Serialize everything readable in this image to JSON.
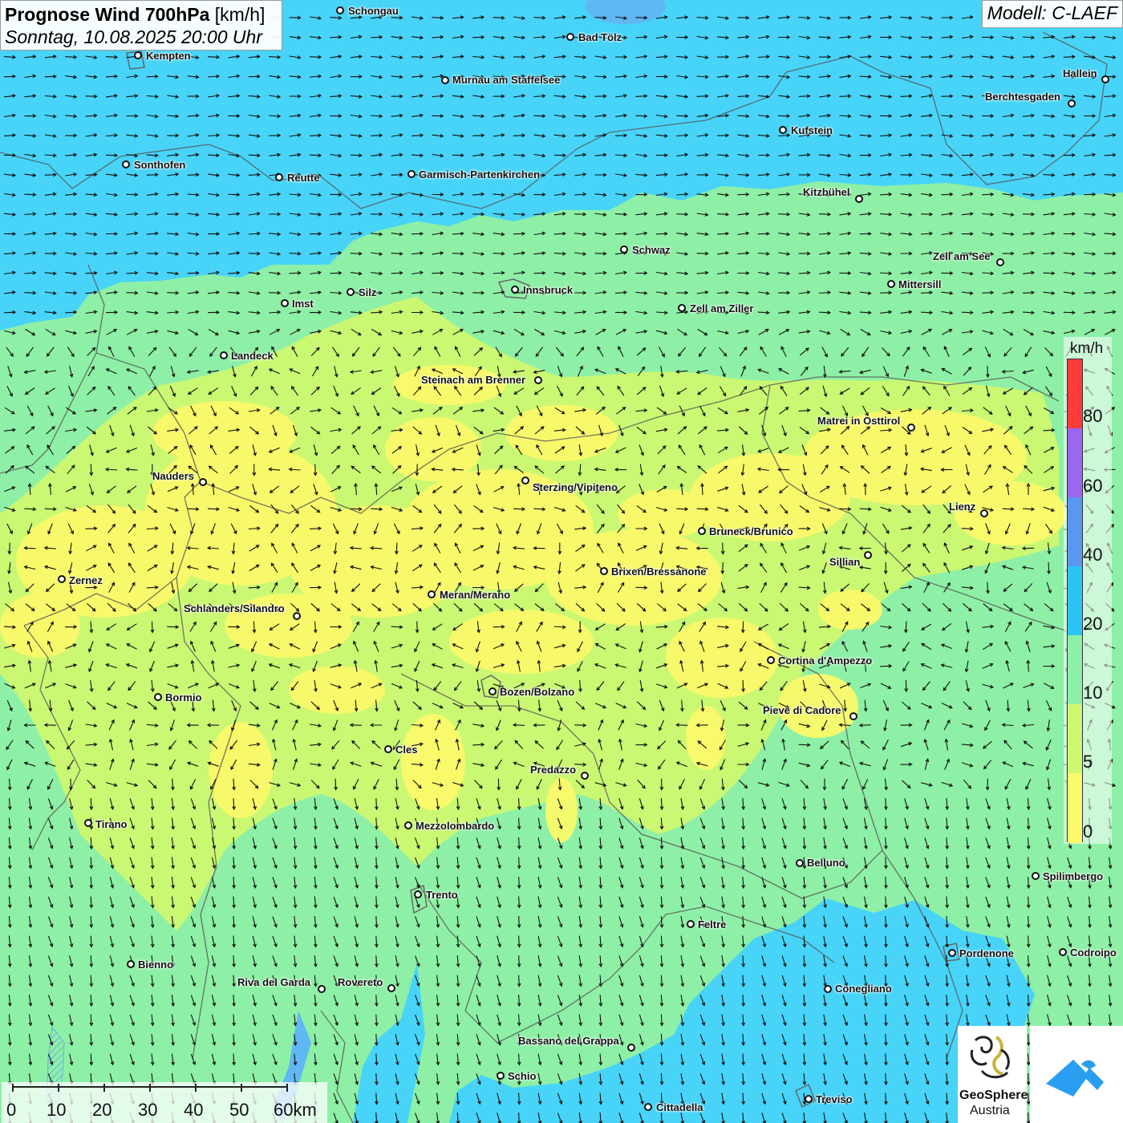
{
  "header": {
    "title": "Prognose Wind 700hPa",
    "unit": "[km/h]",
    "date": "Sonntag, 10.08.2025 20:00 Uhr",
    "model": "Modell: C-LAEF"
  },
  "cities": [
    {
      "name": "Schongau"
    },
    {
      "name": "Bad Tölz"
    },
    {
      "name": "Kempten"
    },
    {
      "name": "Hallein"
    },
    {
      "name": "Murnau am Staffelsee"
    },
    {
      "name": "Berchtesgaden"
    },
    {
      "name": "Kufstein"
    },
    {
      "name": "Sonthofen"
    },
    {
      "name": "Reutte"
    },
    {
      "name": "Garmisch-Partenkirchen"
    },
    {
      "name": "Kitzbühel"
    },
    {
      "name": "Schwaz"
    },
    {
      "name": "Zell am See"
    },
    {
      "name": "Mittersill"
    },
    {
      "name": "Innsbruck"
    },
    {
      "name": "Silz"
    },
    {
      "name": "Imst"
    },
    {
      "name": "Zell am Ziller"
    },
    {
      "name": "Landeck"
    },
    {
      "name": "Steinach am Brenner"
    },
    {
      "name": "Matrei in Osttirol"
    },
    {
      "name": "Nauders"
    },
    {
      "name": "Sterzing/Vipiteno"
    },
    {
      "name": "Lienz"
    },
    {
      "name": "Bruneck/Brunico"
    },
    {
      "name": "Sillian"
    },
    {
      "name": "Zernez"
    },
    {
      "name": "Brixen/Bressanone"
    },
    {
      "name": "Meran/Merano"
    },
    {
      "name": "Schlanders/Silandro"
    },
    {
      "name": "Cortina d'Ampezzo"
    },
    {
      "name": "Bozen/Bolzano"
    },
    {
      "name": "Bormio"
    },
    {
      "name": "Pieve di Cadore"
    },
    {
      "name": "Cles"
    },
    {
      "name": "Predazzo"
    },
    {
      "name": "Tirano"
    },
    {
      "name": "Mezzolombardo"
    },
    {
      "name": "Belluno"
    },
    {
      "name": "Spilimbergo"
    },
    {
      "name": "Trento"
    },
    {
      "name": "Feltre"
    },
    {
      "name": "Pordenone"
    },
    {
      "name": "Codroipo"
    },
    {
      "name": "Bienno"
    },
    {
      "name": "Riva del Garda"
    },
    {
      "name": "Rovereto"
    },
    {
      "name": "Conegliano"
    },
    {
      "name": "Bassano del Grappa"
    },
    {
      "name": "Schio"
    },
    {
      "name": "Treviso"
    },
    {
      "name": "Cittadella"
    }
  ],
  "legend": {
    "unit": "km/h",
    "ticks": [
      "80",
      "60",
      "40",
      "20",
      "10",
      "5",
      "0"
    ],
    "colors": [
      "#ff3a3a",
      "#9b66f0",
      "#5b96f0",
      "#2cc4f4",
      "#8ef0a6",
      "#cdf870",
      "#fafa6a"
    ]
  },
  "scale_bar": {
    "labels": [
      "0",
      "10",
      "20",
      "30",
      "40",
      "50",
      "60km"
    ]
  },
  "logos": {
    "geosphere_line1": "GeoSphere",
    "geosphere_line2": "Austria"
  },
  "colors": {
    "wind_0_5": "#fafa6a",
    "wind_5_10": "#cdf870",
    "wind_10_20": "#8ef0a6",
    "wind_20_40": "#48d4f8",
    "lake": "#5fb8f4",
    "arrow": "#111111",
    "border": "#555555"
  }
}
